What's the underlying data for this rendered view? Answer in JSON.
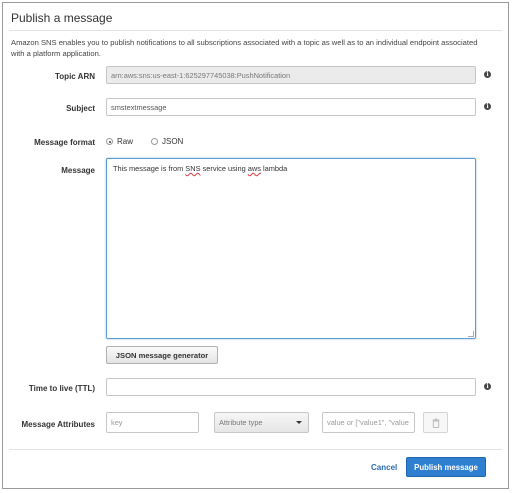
{
  "dialog": {
    "title": "Publish a message",
    "description": "Amazon SNS enables you to publish notifications to all subscriptions associated with a topic as well as to an individual endpoint associated with a platform application."
  },
  "form": {
    "topic_arn": {
      "label": "Topic ARN",
      "value": "arn:aws:sns:us-east-1:625297745038:PushNotification"
    },
    "subject": {
      "label": "Subject",
      "value": "smstextmessage"
    },
    "message_format": {
      "label": "Message format",
      "options": [
        {
          "label": "Raw",
          "selected": true
        },
        {
          "label": "JSON",
          "selected": false
        }
      ]
    },
    "message": {
      "label": "Message",
      "parts": [
        "This message is from ",
        "SNS",
        " service using ",
        "aws",
        " lambda"
      ]
    },
    "json_generator_label": "JSON message generator",
    "ttl": {
      "label": "Time to live (TTL)",
      "value": ""
    },
    "attributes": {
      "label": "Message Attributes",
      "key_placeholder": "key",
      "type_selected": "Attribute type",
      "value_placeholder": "value or [\"value1\", \"value"
    }
  },
  "footer": {
    "cancel_label": "Cancel",
    "publish_label": "Publish message"
  },
  "colors": {
    "primary": "#2f7fd1",
    "link": "#2a6db0",
    "focus_border": "#5b9bd5"
  },
  "icons": {
    "info": "info-icon",
    "trash": "trash-icon",
    "dropdown": "caret-down-icon"
  }
}
